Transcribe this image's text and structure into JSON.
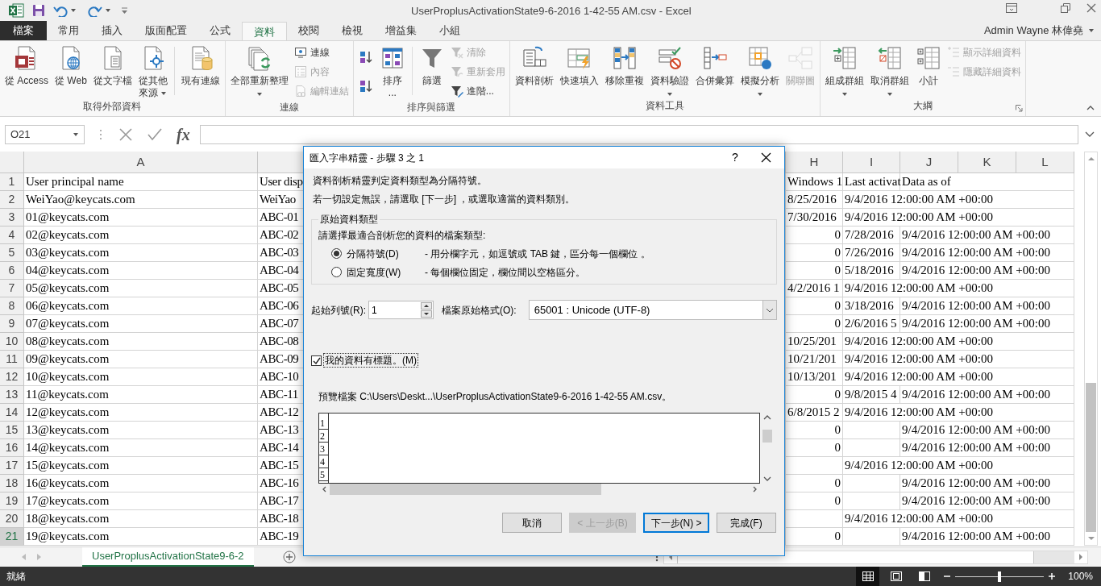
{
  "title_bar": {
    "title": "UserProplusActivationState9-6-2016 1-42-55 AM.csv - Excel",
    "user": "Admin Wayne 林偉堯"
  },
  "tabs": [
    {
      "label": "檔案",
      "kind": "file",
      "selected": false
    },
    {
      "label": "常用",
      "kind": "tab",
      "selected": false
    },
    {
      "label": "插入",
      "kind": "tab",
      "selected": false
    },
    {
      "label": "版面配置",
      "kind": "tab",
      "selected": false
    },
    {
      "label": "公式",
      "kind": "tab",
      "selected": false
    },
    {
      "label": "資料",
      "kind": "tab",
      "selected": true
    },
    {
      "label": "校閱",
      "kind": "tab",
      "selected": false
    },
    {
      "label": "檢視",
      "kind": "tab",
      "selected": false
    },
    {
      "label": "增益集",
      "kind": "tab",
      "selected": false
    },
    {
      "label": "小組",
      "kind": "tab",
      "selected": false
    }
  ],
  "ribbon": {
    "groups": [
      {
        "label": "取得外部資料",
        "items": [
          {
            "kind": "large",
            "label": "從 Access",
            "disabled": false,
            "dropdown": false
          },
          {
            "kind": "large",
            "label": "從 Web",
            "disabled": false,
            "dropdown": false
          },
          {
            "kind": "large",
            "label": "從文字檔",
            "disabled": false,
            "dropdown": false
          },
          {
            "kind": "large",
            "label": "從其他",
            "label_2": "來源",
            "disabled": false,
            "dropdown": true
          },
          {
            "kind": "separator"
          },
          {
            "kind": "large",
            "label": "現有連線",
            "disabled": false,
            "dropdown": false
          }
        ]
      },
      {
        "label": "連線",
        "items": [
          {
            "kind": "large",
            "label": "全部重新整理",
            "disabled": false,
            "dropdown": true
          },
          {
            "kind": "small",
            "label": "連線",
            "disabled": false,
            "dropdown": false
          },
          {
            "kind": "small",
            "label": "內容",
            "disabled": true,
            "dropdown": false
          },
          {
            "kind": "small",
            "label": "編輯連結",
            "disabled": true,
            "dropdown": false
          }
        ]
      },
      {
        "label": "排序與篩選",
        "items": [
          {
            "kind": "icon",
            "disabled": false,
            "dropdown": false
          },
          {
            "kind": "icon",
            "disabled": false,
            "dropdown": false
          },
          {
            "kind": "large",
            "label": "排序",
            "label_2": "...",
            "disabled": false,
            "dropdown": false
          },
          {
            "kind": "separator"
          },
          {
            "kind": "large",
            "label": "篩選",
            "disabled": false,
            "dropdown": false
          },
          {
            "kind": "small",
            "label": "清除",
            "disabled": true,
            "dropdown": false
          },
          {
            "kind": "small",
            "label": "重新套用",
            "disabled": true,
            "dropdown": false
          },
          {
            "kind": "small",
            "label": "進階...",
            "disabled": false,
            "dropdown": false
          }
        ]
      },
      {
        "label": "資料工具",
        "items": [
          {
            "kind": "large",
            "label": "資料剖析",
            "disabled": false,
            "dropdown": false
          },
          {
            "kind": "large",
            "label": "快速填入",
            "disabled": false,
            "dropdown": false
          },
          {
            "kind": "large",
            "label": "移除重複",
            "disabled": false,
            "dropdown": false
          },
          {
            "kind": "large",
            "label": "資料驗證",
            "disabled": false,
            "dropdown": true
          },
          {
            "kind": "large",
            "label": "合併彙算",
            "disabled": false,
            "dropdown": false
          },
          {
            "kind": "large",
            "label": "模擬分析",
            "disabled": false,
            "dropdown": true
          },
          {
            "kind": "large",
            "label": "關聯圖",
            "disabled": true,
            "dropdown": false
          }
        ]
      },
      {
        "label": "大綱",
        "items": [
          {
            "kind": "large",
            "label": "組成群組",
            "disabled": false,
            "dropdown": true
          },
          {
            "kind": "large",
            "label": "取消群組",
            "disabled": false,
            "dropdown": true
          },
          {
            "kind": "large",
            "label": "小計",
            "disabled": false,
            "dropdown": false
          },
          {
            "kind": "small",
            "label": "顯示詳細資料",
            "disabled": true,
            "dropdown": false
          },
          {
            "kind": "small",
            "label": "隱藏詳細資料",
            "disabled": true,
            "dropdown": false
          }
        ]
      }
    ]
  },
  "formula_bar": {
    "name_box": "O21",
    "function_label": "fx"
  },
  "grid": {
    "column_headers": [
      "A",
      "H",
      "I",
      "J",
      "K",
      "L"
    ],
    "rows": [
      {
        "number": "1",
        "selected": false,
        "cells": {
          "A": {
            "text": "User principal name",
            "kind": "text"
          },
          "B": {
            "text": "User disp",
            "kind": "text"
          },
          "H": {
            "text": "Windows 1",
            "kind": "text"
          },
          "I": {
            "text": "Last activat",
            "kind": "text"
          },
          "J": {
            "text": "Data as of",
            "kind": "text"
          }
        }
      },
      {
        "number": "2",
        "selected": false,
        "cells": {
          "A": {
            "text": "WeiYao@keycats.com",
            "kind": "text"
          },
          "B": {
            "text": "WeiYao",
            "kind": "text"
          },
          "H": {
            "text": "8/25/2016",
            "kind": "text"
          },
          "I": {
            "text": "9/4/2016 12:00:00 AM +00:00",
            "kind": "text"
          }
        }
      },
      {
        "number": "3",
        "selected": false,
        "cells": {
          "A": {
            "text": "01@keycats.com",
            "kind": "text"
          },
          "B": {
            "text": "ABC-01",
            "kind": "text"
          },
          "H": {
            "text": "7/30/2016",
            "kind": "text"
          },
          "I": {
            "text": "9/4/2016 12:00:00 AM +00:00",
            "kind": "text"
          }
        }
      },
      {
        "number": "4",
        "selected": false,
        "cells": {
          "A": {
            "text": "02@keycats.com",
            "kind": "text"
          },
          "B": {
            "text": "ABC-02",
            "kind": "text"
          },
          "H": {
            "text": "0",
            "kind": "number"
          },
          "I": {
            "text": "7/28/2016",
            "kind": "text"
          },
          "J": {
            "text": "9/4/2016 12:00:00 AM +00:00",
            "kind": "text"
          }
        }
      },
      {
        "number": "5",
        "selected": false,
        "cells": {
          "A": {
            "text": "03@keycats.com",
            "kind": "text"
          },
          "B": {
            "text": "ABC-03",
            "kind": "text"
          },
          "H": {
            "text": "0",
            "kind": "number"
          },
          "I": {
            "text": "7/26/2016",
            "kind": "text"
          },
          "J": {
            "text": "9/4/2016 12:00:00 AM +00:00",
            "kind": "text"
          }
        }
      },
      {
        "number": "6",
        "selected": false,
        "cells": {
          "A": {
            "text": "04@keycats.com",
            "kind": "text"
          },
          "B": {
            "text": "ABC-04",
            "kind": "text"
          },
          "H": {
            "text": "0",
            "kind": "number"
          },
          "I": {
            "text": "5/18/2016",
            "kind": "text"
          },
          "J": {
            "text": "9/4/2016 12:00:00 AM +00:00",
            "kind": "text"
          }
        }
      },
      {
        "number": "7",
        "selected": false,
        "cells": {
          "A": {
            "text": "05@keycats.com",
            "kind": "text"
          },
          "B": {
            "text": "ABC-05",
            "kind": "text"
          },
          "H": {
            "text": "4/2/2016 1",
            "kind": "text"
          },
          "I": {
            "text": "9/4/2016 12:00:00 AM +00:00",
            "kind": "text"
          }
        }
      },
      {
        "number": "8",
        "selected": false,
        "cells": {
          "A": {
            "text": "06@keycats.com",
            "kind": "text"
          },
          "B": {
            "text": "ABC-06",
            "kind": "text"
          },
          "H": {
            "text": "0",
            "kind": "number"
          },
          "I": {
            "text": "3/18/2016",
            "kind": "text"
          },
          "J": {
            "text": "9/4/2016 12:00:00 AM +00:00",
            "kind": "text"
          }
        }
      },
      {
        "number": "9",
        "selected": false,
        "cells": {
          "A": {
            "text": "07@keycats.com",
            "kind": "text"
          },
          "B": {
            "text": "ABC-07",
            "kind": "text"
          },
          "H": {
            "text": "0",
            "kind": "number"
          },
          "I": {
            "text": "2/6/2016 5",
            "kind": "text"
          },
          "J": {
            "text": "9/4/2016 12:00:00 AM +00:00",
            "kind": "text"
          }
        }
      },
      {
        "number": "10",
        "selected": false,
        "cells": {
          "A": {
            "text": "08@keycats.com",
            "kind": "text"
          },
          "B": {
            "text": "ABC-08",
            "kind": "text"
          },
          "H": {
            "text": "10/25/201",
            "kind": "text"
          },
          "I": {
            "text": "9/4/2016 12:00:00 AM +00:00",
            "kind": "text"
          }
        }
      },
      {
        "number": "11",
        "selected": false,
        "cells": {
          "A": {
            "text": "09@keycats.com",
            "kind": "text"
          },
          "B": {
            "text": "ABC-09",
            "kind": "text"
          },
          "H": {
            "text": "10/21/201",
            "kind": "text"
          },
          "I": {
            "text": "9/4/2016 12:00:00 AM +00:00",
            "kind": "text"
          }
        }
      },
      {
        "number": "12",
        "selected": false,
        "cells": {
          "A": {
            "text": "10@keycats.com",
            "kind": "text"
          },
          "B": {
            "text": "ABC-10",
            "kind": "text"
          },
          "H": {
            "text": "10/13/201",
            "kind": "text"
          },
          "I": {
            "text": "9/4/2016 12:00:00 AM +00:00",
            "kind": "text"
          }
        }
      },
      {
        "number": "13",
        "selected": false,
        "cells": {
          "A": {
            "text": "11@keycats.com",
            "kind": "text"
          },
          "B": {
            "text": "ABC-11",
            "kind": "text"
          },
          "H": {
            "text": "0",
            "kind": "number"
          },
          "I": {
            "text": "9/8/2015 4",
            "kind": "text"
          },
          "J": {
            "text": "9/4/2016 12:00:00 AM +00:00",
            "kind": "text"
          }
        }
      },
      {
        "number": "14",
        "selected": false,
        "cells": {
          "A": {
            "text": "12@keycats.com",
            "kind": "text"
          },
          "B": {
            "text": "ABC-12",
            "kind": "text"
          },
          "H": {
            "text": "6/8/2015 2",
            "kind": "text"
          },
          "I": {
            "text": "9/4/2016 12:00:00 AM +00:00",
            "kind": "text"
          }
        }
      },
      {
        "number": "15",
        "selected": false,
        "cells": {
          "A": {
            "text": "13@keycats.com",
            "kind": "text"
          },
          "B": {
            "text": "ABC-13",
            "kind": "text"
          },
          "H": {
            "text": "0",
            "kind": "number"
          },
          "J": {
            "text": "9/4/2016 12:00:00 AM +00:00",
            "kind": "text"
          }
        }
      },
      {
        "number": "16",
        "selected": false,
        "cells": {
          "A": {
            "text": "14@keycats.com",
            "kind": "text"
          },
          "B": {
            "text": "ABC-14",
            "kind": "text"
          },
          "H": {
            "text": "0",
            "kind": "number"
          },
          "J": {
            "text": "9/4/2016 12:00:00 AM +00:00",
            "kind": "text"
          }
        }
      },
      {
        "number": "17",
        "selected": false,
        "cells": {
          "A": {
            "text": "15@keycats.com",
            "kind": "text"
          },
          "B": {
            "text": "ABC-15",
            "kind": "text"
          },
          "I": {
            "text": "9/4/2016 12:00:00 AM +00:00",
            "kind": "text"
          }
        }
      },
      {
        "number": "18",
        "selected": false,
        "cells": {
          "A": {
            "text": "16@keycats.com",
            "kind": "text"
          },
          "B": {
            "text": "ABC-16",
            "kind": "text"
          },
          "H": {
            "text": "0",
            "kind": "number"
          },
          "J": {
            "text": "9/4/2016 12:00:00 AM +00:00",
            "kind": "text"
          }
        }
      },
      {
        "number": "19",
        "selected": false,
        "cells": {
          "A": {
            "text": "17@keycats.com",
            "kind": "text"
          },
          "B": {
            "text": "ABC-17",
            "kind": "text"
          },
          "H": {
            "text": "0",
            "kind": "number"
          },
          "J": {
            "text": "9/4/2016 12:00:00 AM +00:00",
            "kind": "text"
          }
        }
      },
      {
        "number": "20",
        "selected": false,
        "cells": {
          "A": {
            "text": "18@keycats.com",
            "kind": "text"
          },
          "B": {
            "text": "ABC-18",
            "kind": "text"
          },
          "I": {
            "text": "9/4/2016 12:00:00 AM +00:00",
            "kind": "text"
          }
        }
      },
      {
        "number": "21",
        "selected": true,
        "cells": {
          "A": {
            "text": "19@keycats.com",
            "kind": "text"
          },
          "B": {
            "text": "ABC-19",
            "kind": "text"
          },
          "H": {
            "text": "0",
            "kind": "number"
          },
          "J": {
            "text": "9/4/2016 12:00:00 AM +00:00",
            "kind": "text"
          }
        }
      }
    ]
  },
  "dialog": {
    "title": "匯入字串精靈 - 步驟 3 之 1",
    "help": "?",
    "intro": [
      "資料剖析精靈判定資料類型為分隔符號。",
      "若一切設定無誤，請選取 [下一步] ，或選取適當的資料類別。"
    ],
    "data_type_group": {
      "legend": "原始資料類型",
      "prompt": "請選擇最適合剖析您的資料的檔案類型:",
      "options": [
        {
          "label": "分隔符號(D)",
          "description": "- 用分欄字元，如逗號或 TAB 鍵，區分每一個欄位 。",
          "selected": true
        },
        {
          "label": "固定寬度(W)",
          "description": "- 每個欄位固定，欄位間以空格區分。",
          "selected": false
        }
      ]
    },
    "start_row": {
      "label": "起始列號(R):",
      "value": "1"
    },
    "file_origin": {
      "label": "檔案原始格式(O):",
      "value": "65001 : Unicode (UTF-8)"
    },
    "has_headers": {
      "label": "我的資料有標題。(M)",
      "checked": true
    },
    "preview": {
      "label": "預覽檔案 C:\\Users\\Deskt...\\UserProplusActivationState9-6-2016 1-42-55 AM.csv。",
      "row_numbers": [
        "1",
        "2",
        "3",
        "4",
        "5"
      ]
    },
    "buttons": [
      {
        "label": "取消",
        "disabled": false,
        "default": false
      },
      {
        "label": "< 上一步(B)",
        "disabled": true,
        "default": false
      },
      {
        "label": "下一步(N) >",
        "disabled": false,
        "default": true
      },
      {
        "label": "完成(F)",
        "disabled": false,
        "default": false
      }
    ]
  },
  "sheet_tabs": [
    {
      "label": "UserProplusActivationState9-6-2",
      "selected": true
    }
  ],
  "status_bar": {
    "status": "就緒",
    "views": [
      {
        "kind": "normal",
        "selected": true
      },
      {
        "kind": "page_layout",
        "selected": false
      },
      {
        "kind": "page_break",
        "selected": false
      }
    ],
    "zoom": {
      "level": 0.5,
      "label": "100%"
    }
  }
}
